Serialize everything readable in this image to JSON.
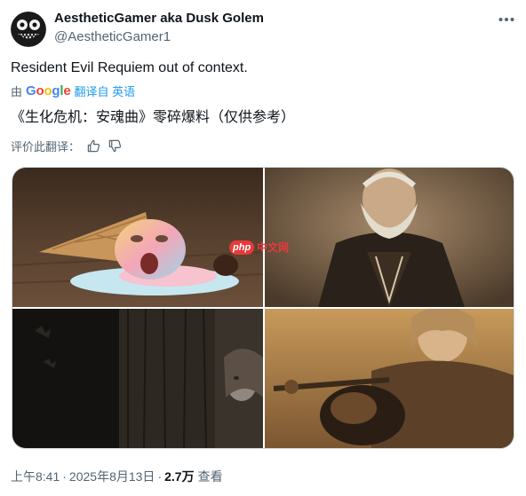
{
  "author": {
    "display_name": "AestheticGamer aka Dusk Golem",
    "handle": "@AestheticGamer1"
  },
  "tweet": {
    "text": "Resident Evil Requiem out of context.",
    "translation_prefix": "由",
    "translation_link": "翻译自 英语",
    "translated_text": "《生化危机：安魂曲》零碎爆料（仅供参考）",
    "rate_label": "评价此翻译："
  },
  "google_logo": [
    "G",
    "o",
    "o",
    "g",
    "l",
    "e"
  ],
  "watermark": {
    "php": "php",
    "cn": "中文网"
  },
  "footer": {
    "time": "上午8:41",
    "dot": "·",
    "date": "2025年8月13日",
    "views_count": "2.7万",
    "views_label": "查看"
  },
  "icons": {
    "more": "more-dots-icon",
    "thumb_up": "thumbs-up-icon",
    "thumb_down": "thumbs-down-icon"
  },
  "colors": {
    "text_primary": "#0f1419",
    "text_secondary": "#536471",
    "link": "#1d9bf0",
    "border": "#cfd9de"
  }
}
